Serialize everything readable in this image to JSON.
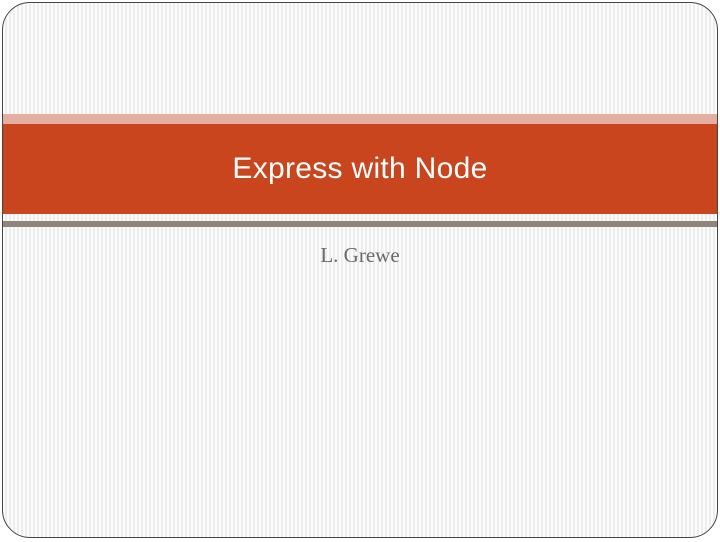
{
  "slide": {
    "title": "Express with Node",
    "subtitle": "L. Grewe"
  }
}
